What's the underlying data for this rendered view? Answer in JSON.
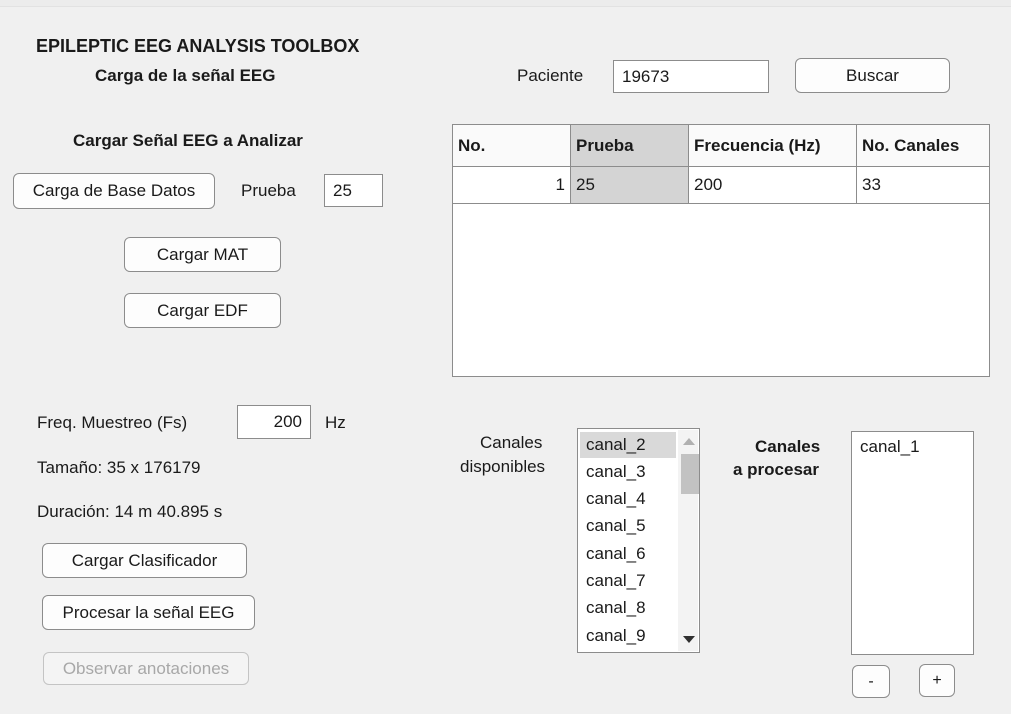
{
  "header": {
    "app_title": "EPILEPTIC EEG ANALYSIS TOOLBOX",
    "subtitle": "Carga de la señal EEG"
  },
  "patient": {
    "label": "Paciente",
    "value": "19673",
    "search_button": "Buscar"
  },
  "load_section": {
    "title": "Cargar Señal EEG a Analizar",
    "db_button": "Carga de Base Datos",
    "test_label": "Prueba",
    "test_value": "25",
    "mat_button": "Cargar MAT",
    "edf_button": "Cargar EDF"
  },
  "table": {
    "columns": [
      "No.",
      "Prueba",
      "Frecuencia (Hz)",
      "No. Canales"
    ],
    "rows": [
      [
        "1",
        "25",
        "200",
        "33"
      ]
    ]
  },
  "signal_info": {
    "fs_label": "Freq. Muestreo (Fs)",
    "fs_value": "200",
    "fs_unit": "Hz",
    "size_text": "Tamaño: 35 x 176179",
    "duration_text": "Duración: 14 m 40.895 s"
  },
  "actions": {
    "classifier_button": "Cargar Clasificador",
    "process_button": "Procesar la señal EEG",
    "annotations_button": "Observar anotaciones"
  },
  "channels": {
    "available_label_line1": "Canales",
    "available_label_line2": "disponibles",
    "available": [
      "canal_2",
      "canal_3",
      "canal_4",
      "canal_5",
      "canal_6",
      "canal_7",
      "canal_8",
      "canal_9"
    ],
    "selected_available": "canal_2",
    "process_label_line1": "Canales",
    "process_label_line2": "a procesar",
    "to_process": [
      "canal_1"
    ],
    "remove_button": "-",
    "add_button": "+"
  }
}
